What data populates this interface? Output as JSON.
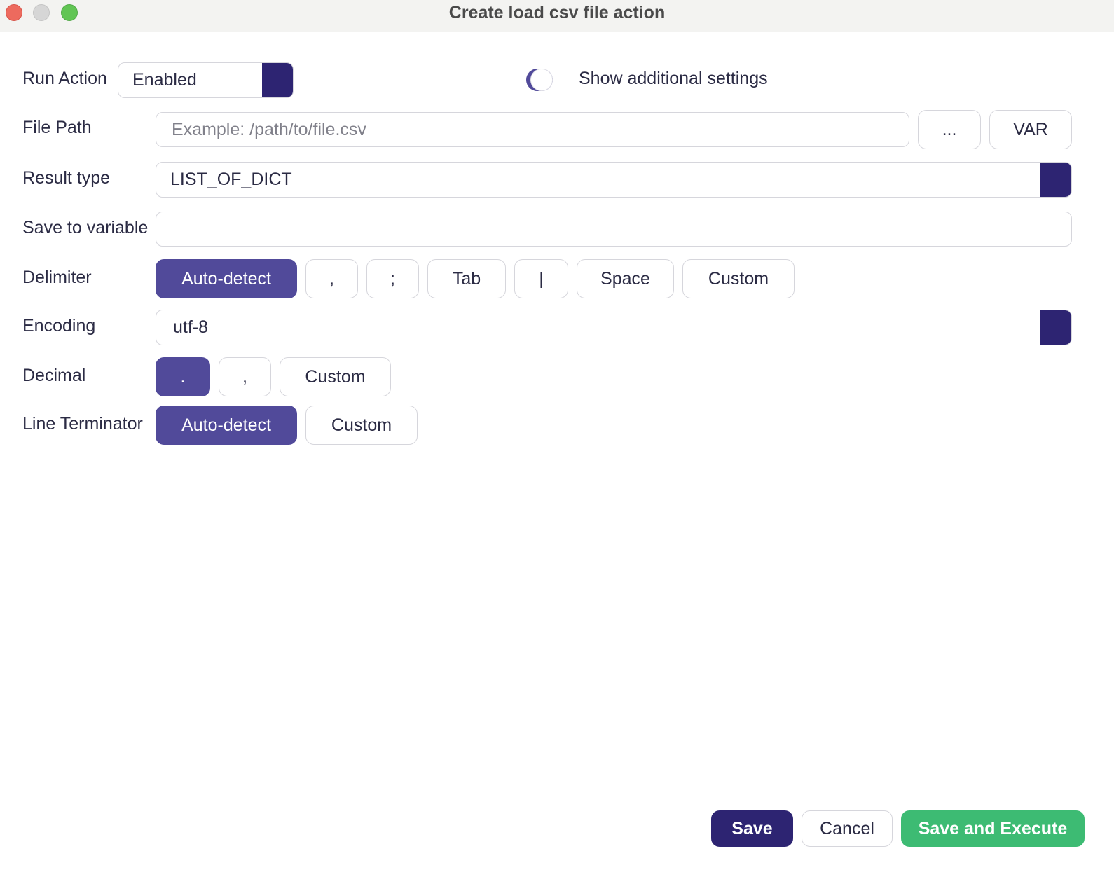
{
  "window": {
    "title": "Create load csv file action"
  },
  "run_action": {
    "label": "Run Action",
    "value": "Enabled"
  },
  "additional_settings": {
    "label": "Show additional settings",
    "enabled": true
  },
  "file_path": {
    "label": "File Path",
    "value": "",
    "placeholder": "Example: /path/to/file.csv",
    "browse_label": "...",
    "var_label": "VAR"
  },
  "result_type": {
    "label": "Result type",
    "value": "LIST_OF_DICT"
  },
  "save_to_variable": {
    "label": "Save to variable",
    "value": ""
  },
  "delimiter": {
    "label": "Delimiter",
    "options": [
      "Auto-detect",
      ",",
      ";",
      "Tab",
      "|",
      "Space",
      "Custom"
    ],
    "selected": "Auto-detect"
  },
  "encoding": {
    "label": "Encoding",
    "value": "utf-8"
  },
  "decimal": {
    "label": "Decimal",
    "options": [
      ".",
      ",",
      "Custom"
    ],
    "selected": "."
  },
  "line_terminator": {
    "label": "Line Terminator",
    "options": [
      "Auto-detect",
      "Custom"
    ],
    "selected": "Auto-detect"
  },
  "footer": {
    "save_label": "Save",
    "cancel_label": "Cancel",
    "execute_label": "Save and Execute"
  },
  "colors": {
    "accent": "#514a9a",
    "primary_dark": "#2d2472",
    "success": "#3dbb73"
  }
}
